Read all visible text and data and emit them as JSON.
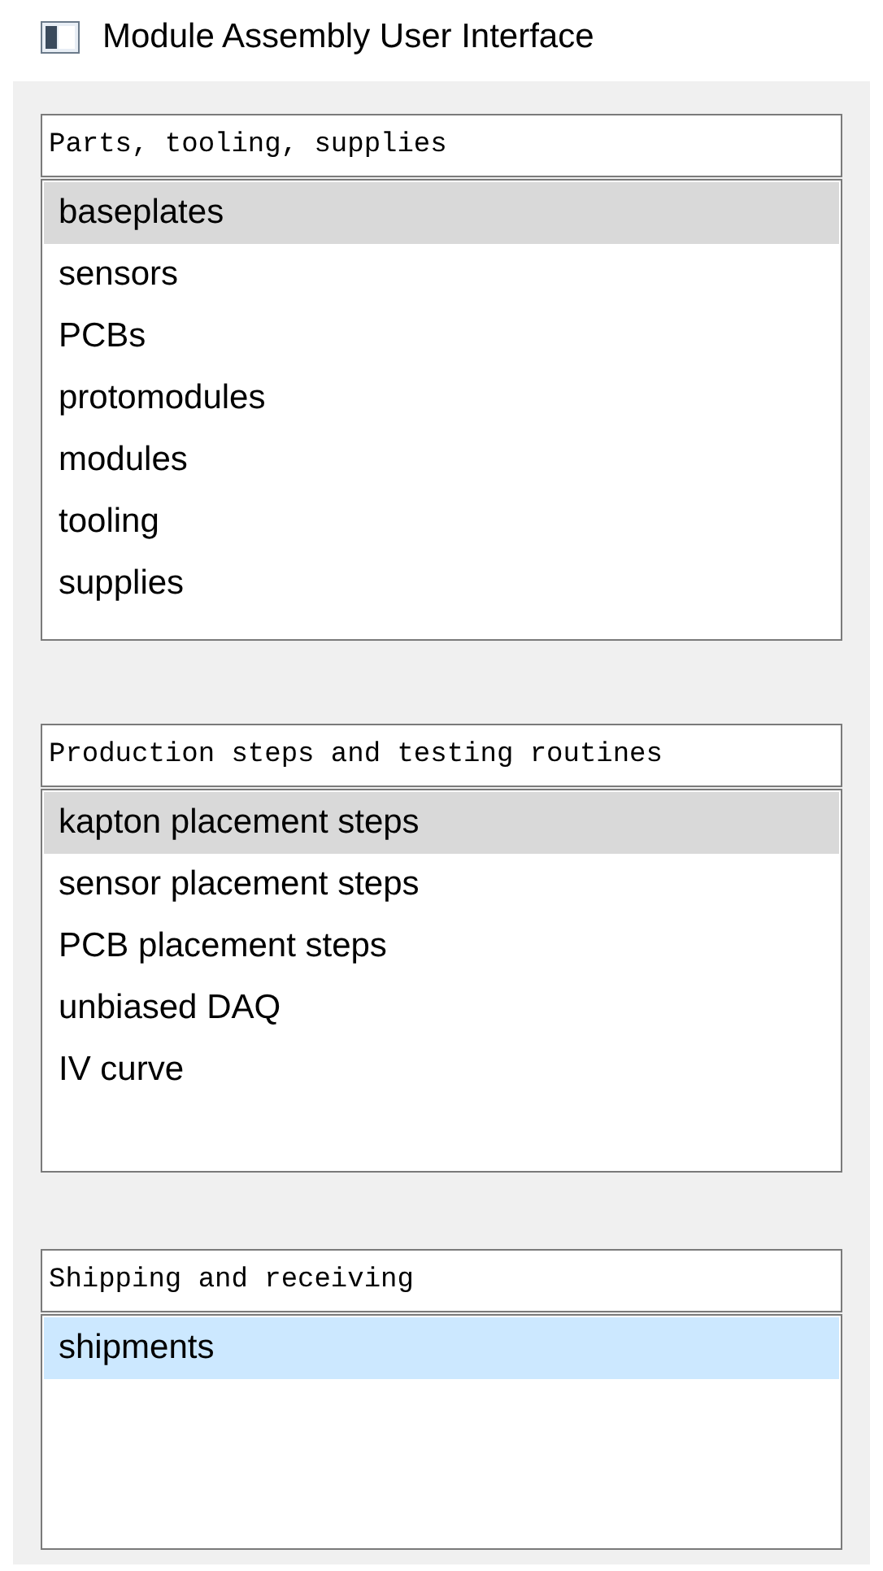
{
  "window": {
    "title": "Module Assembly User Interface"
  },
  "sections": [
    {
      "heading": "Parts, tooling, supplies",
      "focused": false,
      "items": [
        {
          "label": "baseplates",
          "selected": true
        },
        {
          "label": "sensors",
          "selected": false
        },
        {
          "label": "PCBs",
          "selected": false
        },
        {
          "label": "protomodules",
          "selected": false
        },
        {
          "label": "modules",
          "selected": false
        },
        {
          "label": "tooling",
          "selected": false
        },
        {
          "label": "supplies",
          "selected": false
        }
      ]
    },
    {
      "heading": "Production steps and testing routines",
      "focused": false,
      "items": [
        {
          "label": "kapton placement steps",
          "selected": true
        },
        {
          "label": "sensor placement steps",
          "selected": false
        },
        {
          "label": "PCB placement steps",
          "selected": false
        },
        {
          "label": "unbiased DAQ",
          "selected": false
        },
        {
          "label": "IV curve",
          "selected": false
        }
      ]
    },
    {
      "heading": "Shipping and receiving",
      "focused": true,
      "items": [
        {
          "label": "shipments",
          "selected": true
        }
      ]
    }
  ]
}
